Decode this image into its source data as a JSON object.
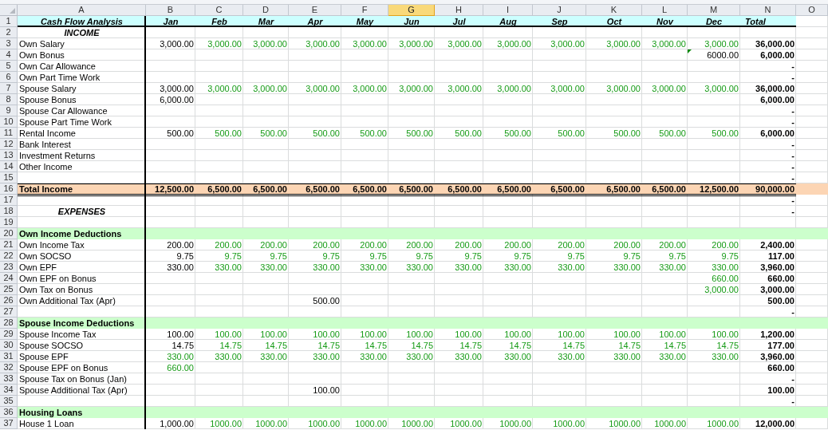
{
  "columns": [
    {
      "letter": "A",
      "selected": false
    },
    {
      "letter": "B",
      "selected": false
    },
    {
      "letter": "C",
      "selected": false
    },
    {
      "letter": "D",
      "selected": false
    },
    {
      "letter": "E",
      "selected": false
    },
    {
      "letter": "F",
      "selected": false
    },
    {
      "letter": "G",
      "selected": true
    },
    {
      "letter": "H",
      "selected": false
    },
    {
      "letter": "I",
      "selected": false
    },
    {
      "letter": "J",
      "selected": false
    },
    {
      "letter": "K",
      "selected": false
    },
    {
      "letter": "L",
      "selected": false
    },
    {
      "letter": "M",
      "selected": false
    },
    {
      "letter": "N",
      "selected": false
    },
    {
      "letter": "O",
      "selected": false
    }
  ],
  "rows": [
    {
      "number": "1",
      "kind": "heading",
      "label": "Cash Flow Analysis",
      "cells": [
        {
          "text": "Jan",
          "kind": "month"
        },
        {
          "text": "Feb",
          "kind": "month"
        },
        {
          "text": "Mar",
          "kind": "month"
        },
        {
          "text": "Apr",
          "kind": "month"
        },
        {
          "text": "May",
          "kind": "month"
        },
        {
          "text": "Jun",
          "kind": "month"
        },
        {
          "text": "Jul",
          "kind": "month"
        },
        {
          "text": "Aug",
          "kind": "month"
        },
        {
          "text": "Sep",
          "kind": "month"
        },
        {
          "text": "Oct",
          "kind": "month"
        },
        {
          "text": "Nov",
          "kind": "month"
        },
        {
          "text": "Dec",
          "kind": "month"
        },
        {
          "text": "Total",
          "kind": "caption"
        }
      ]
    },
    {
      "number": "2",
      "kind": "title",
      "label": "INCOME",
      "cells": []
    },
    {
      "number": "3",
      "kind": "item",
      "label": "Own Salary",
      "cells": [
        {
          "text": "3,000.00",
          "kind": "value"
        },
        {
          "text": "3,000.00",
          "kind": "input"
        },
        {
          "text": "3,000.00",
          "kind": "input"
        },
        {
          "text": "3,000.00",
          "kind": "input"
        },
        {
          "text": "3,000.00",
          "kind": "input"
        },
        {
          "text": "3,000.00",
          "kind": "input"
        },
        {
          "text": "3,000.00",
          "kind": "input"
        },
        {
          "text": "3,000.00",
          "kind": "input"
        },
        {
          "text": "3,000.00",
          "kind": "input"
        },
        {
          "text": "3,000.00",
          "kind": "input"
        },
        {
          "text": "3,000.00",
          "kind": "input"
        },
        {
          "text": "3,000.00",
          "kind": "input"
        },
        {
          "text": "36,000.00",
          "kind": "total"
        }
      ]
    },
    {
      "number": "4",
      "kind": "item",
      "label": "Own Bonus",
      "cells": [
        null,
        null,
        null,
        null,
        null,
        null,
        null,
        null,
        null,
        null,
        null,
        {
          "text": "6000.00",
          "kind": "flagged"
        },
        {
          "text": "6,000.00",
          "kind": "total"
        }
      ]
    },
    {
      "number": "5",
      "kind": "item",
      "label": "Own Car Allowance",
      "cells": [
        null,
        null,
        null,
        null,
        null,
        null,
        null,
        null,
        null,
        null,
        null,
        null,
        {
          "text": "-",
          "kind": "total"
        }
      ]
    },
    {
      "number": "6",
      "kind": "item",
      "label": "Own Part Time Work",
      "cells": [
        null,
        null,
        null,
        null,
        null,
        null,
        null,
        null,
        null,
        null,
        null,
        null,
        {
          "text": "-",
          "kind": "total"
        }
      ]
    },
    {
      "number": "7",
      "kind": "item",
      "label": "Spouse Salary",
      "cells": [
        {
          "text": "3,000.00",
          "kind": "value"
        },
        {
          "text": "3,000.00",
          "kind": "input"
        },
        {
          "text": "3,000.00",
          "kind": "input"
        },
        {
          "text": "3,000.00",
          "kind": "input"
        },
        {
          "text": "3,000.00",
          "kind": "input"
        },
        {
          "text": "3,000.00",
          "kind": "input"
        },
        {
          "text": "3,000.00",
          "kind": "input"
        },
        {
          "text": "3,000.00",
          "kind": "input"
        },
        {
          "text": "3,000.00",
          "kind": "input"
        },
        {
          "text": "3,000.00",
          "kind": "input"
        },
        {
          "text": "3,000.00",
          "kind": "input"
        },
        {
          "text": "3,000.00",
          "kind": "input"
        },
        {
          "text": "36,000.00",
          "kind": "total"
        }
      ]
    },
    {
      "number": "8",
      "kind": "item",
      "label": "Spouse Bonus",
      "cells": [
        {
          "text": "6,000.00",
          "kind": "value"
        },
        null,
        null,
        null,
        null,
        null,
        null,
        null,
        null,
        null,
        null,
        null,
        {
          "text": "6,000.00",
          "kind": "total"
        }
      ]
    },
    {
      "number": "9",
      "kind": "item",
      "label": "Spouse Car Allowance",
      "cells": [
        null,
        null,
        null,
        null,
        null,
        null,
        null,
        null,
        null,
        null,
        null,
        null,
        {
          "text": "-",
          "kind": "total"
        }
      ]
    },
    {
      "number": "10",
      "kind": "item",
      "label": "Spouse Part Time Work",
      "cells": [
        null,
        null,
        null,
        null,
        null,
        null,
        null,
        null,
        null,
        null,
        null,
        null,
        {
          "text": "-",
          "kind": "total"
        }
      ]
    },
    {
      "number": "11",
      "kind": "item",
      "label": "Rental Income",
      "cells": [
        {
          "text": "500.00",
          "kind": "value"
        },
        {
          "text": "500.00",
          "kind": "input"
        },
        {
          "text": "500.00",
          "kind": "input"
        },
        {
          "text": "500.00",
          "kind": "input"
        },
        {
          "text": "500.00",
          "kind": "input"
        },
        {
          "text": "500.00",
          "kind": "input"
        },
        {
          "text": "500.00",
          "kind": "input"
        },
        {
          "text": "500.00",
          "kind": "input"
        },
        {
          "text": "500.00",
          "kind": "input"
        },
        {
          "text": "500.00",
          "kind": "input"
        },
        {
          "text": "500.00",
          "kind": "input"
        },
        {
          "text": "500.00",
          "kind": "input"
        },
        {
          "text": "6,000.00",
          "kind": "total"
        }
      ]
    },
    {
      "number": "12",
      "kind": "item",
      "label": "Bank Interest",
      "cells": [
        null,
        null,
        null,
        null,
        null,
        null,
        null,
        null,
        null,
        null,
        null,
        null,
        {
          "text": "-",
          "kind": "total"
        }
      ]
    },
    {
      "number": "13",
      "kind": "item",
      "label": "Investment Returns",
      "cells": [
        null,
        null,
        null,
        null,
        null,
        null,
        null,
        null,
        null,
        null,
        null,
        null,
        {
          "text": "-",
          "kind": "total"
        }
      ]
    },
    {
      "number": "14",
      "kind": "item",
      "label": "Other Income",
      "cells": [
        null,
        null,
        null,
        null,
        null,
        null,
        null,
        null,
        null,
        null,
        null,
        null,
        {
          "text": "-",
          "kind": "total"
        }
      ]
    },
    {
      "number": "15",
      "kind": "item",
      "cells": [
        null,
        null,
        null,
        null,
        null,
        null,
        null,
        null,
        null,
        null,
        null,
        null,
        {
          "text": "-",
          "kind": "total"
        }
      ]
    },
    {
      "number": "16",
      "kind": "total",
      "label": "Total Income",
      "cells": [
        {
          "text": "12,500.00",
          "kind": "total"
        },
        {
          "text": "6,500.00",
          "kind": "total"
        },
        {
          "text": "6,500.00",
          "kind": "total"
        },
        {
          "text": "6,500.00",
          "kind": "total"
        },
        {
          "text": "6,500.00",
          "kind": "total"
        },
        {
          "text": "6,500.00",
          "kind": "total"
        },
        {
          "text": "6,500.00",
          "kind": "total"
        },
        {
          "text": "6,500.00",
          "kind": "total"
        },
        {
          "text": "6,500.00",
          "kind": "total"
        },
        {
          "text": "6,500.00",
          "kind": "total"
        },
        {
          "text": "6,500.00",
          "kind": "total"
        },
        {
          "text": "12,500.00",
          "kind": "total"
        },
        {
          "text": "90,000.00",
          "kind": "total"
        }
      ]
    },
    {
      "number": "17",
      "kind": "item",
      "cells": [
        null,
        null,
        null,
        null,
        null,
        null,
        null,
        null,
        null,
        null,
        null,
        null,
        {
          "text": "-",
          "kind": "total"
        }
      ]
    },
    {
      "number": "18",
      "kind": "title",
      "label": "EXPENSES",
      "cells": [
        null,
        null,
        null,
        null,
        null,
        null,
        null,
        null,
        null,
        null,
        null,
        null,
        {
          "text": "-",
          "kind": "total"
        }
      ]
    },
    {
      "number": "19",
      "kind": "item",
      "cells": []
    },
    {
      "number": "20",
      "kind": "section",
      "label": "Own Income Deductions",
      "cells": []
    },
    {
      "number": "21",
      "kind": "item",
      "label": "Own Income Tax",
      "cells": [
        {
          "text": "200.00",
          "kind": "value"
        },
        {
          "text": "200.00",
          "kind": "input"
        },
        {
          "text": "200.00",
          "kind": "input"
        },
        {
          "text": "200.00",
          "kind": "input"
        },
        {
          "text": "200.00",
          "kind": "input"
        },
        {
          "text": "200.00",
          "kind": "input"
        },
        {
          "text": "200.00",
          "kind": "input"
        },
        {
          "text": "200.00",
          "kind": "input"
        },
        {
          "text": "200.00",
          "kind": "input"
        },
        {
          "text": "200.00",
          "kind": "input"
        },
        {
          "text": "200.00",
          "kind": "input"
        },
        {
          "text": "200.00",
          "kind": "input"
        },
        {
          "text": "2,400.00",
          "kind": "total"
        }
      ]
    },
    {
      "number": "22",
      "kind": "item",
      "label": "Own SOCSO",
      "cells": [
        {
          "text": "9.75",
          "kind": "value"
        },
        {
          "text": "9.75",
          "kind": "input"
        },
        {
          "text": "9.75",
          "kind": "input"
        },
        {
          "text": "9.75",
          "kind": "input"
        },
        {
          "text": "9.75",
          "kind": "input"
        },
        {
          "text": "9.75",
          "kind": "input"
        },
        {
          "text": "9.75",
          "kind": "input"
        },
        {
          "text": "9.75",
          "kind": "input"
        },
        {
          "text": "9.75",
          "kind": "input"
        },
        {
          "text": "9.75",
          "kind": "input"
        },
        {
          "text": "9.75",
          "kind": "input"
        },
        {
          "text": "9.75",
          "kind": "input"
        },
        {
          "text": "117.00",
          "kind": "total"
        }
      ]
    },
    {
      "number": "23",
      "kind": "item",
      "label": "Own EPF",
      "cells": [
        {
          "text": "330.00",
          "kind": "value"
        },
        {
          "text": "330.00",
          "kind": "input"
        },
        {
          "text": "330.00",
          "kind": "input"
        },
        {
          "text": "330.00",
          "kind": "input"
        },
        {
          "text": "330.00",
          "kind": "input"
        },
        {
          "text": "330.00",
          "kind": "input"
        },
        {
          "text": "330.00",
          "kind": "input"
        },
        {
          "text": "330.00",
          "kind": "input"
        },
        {
          "text": "330.00",
          "kind": "input"
        },
        {
          "text": "330.00",
          "kind": "input"
        },
        {
          "text": "330.00",
          "kind": "input"
        },
        {
          "text": "330.00",
          "kind": "input"
        },
        {
          "text": "3,960.00",
          "kind": "total"
        }
      ]
    },
    {
      "number": "24",
      "kind": "item",
      "label": "Own EPF on Bonus",
      "cells": [
        null,
        null,
        null,
        null,
        null,
        null,
        null,
        null,
        null,
        null,
        null,
        {
          "text": "660.00",
          "kind": "input"
        },
        {
          "text": "660.00",
          "kind": "total"
        }
      ]
    },
    {
      "number": "25",
      "kind": "item",
      "label": "Own Tax on Bonus",
      "cells": [
        null,
        null,
        null,
        null,
        null,
        null,
        null,
        null,
        null,
        null,
        null,
        {
          "text": "3,000.00",
          "kind": "input"
        },
        {
          "text": "3,000.00",
          "kind": "total"
        }
      ]
    },
    {
      "number": "26",
      "kind": "item",
      "label": "Own Additional Tax (Apr)",
      "cells": [
        null,
        null,
        null,
        {
          "text": "500.00",
          "kind": "value"
        },
        null,
        null,
        null,
        null,
        null,
        null,
        null,
        null,
        {
          "text": "500.00",
          "kind": "total"
        }
      ]
    },
    {
      "number": "27",
      "kind": "item",
      "cells": [
        null,
        null,
        null,
        null,
        null,
        null,
        null,
        null,
        null,
        null,
        null,
        null,
        {
          "text": "-",
          "kind": "total"
        }
      ]
    },
    {
      "number": "28",
      "kind": "section",
      "label": "Spouse Income Deductions",
      "cells": []
    },
    {
      "number": "29",
      "kind": "item",
      "label": "Spouse Income Tax",
      "cells": [
        {
          "text": "100.00",
          "kind": "value"
        },
        {
          "text": "100.00",
          "kind": "input"
        },
        {
          "text": "100.00",
          "kind": "input"
        },
        {
          "text": "100.00",
          "kind": "input"
        },
        {
          "text": "100.00",
          "kind": "input"
        },
        {
          "text": "100.00",
          "kind": "input"
        },
        {
          "text": "100.00",
          "kind": "input"
        },
        {
          "text": "100.00",
          "kind": "input"
        },
        {
          "text": "100.00",
          "kind": "input"
        },
        {
          "text": "100.00",
          "kind": "input"
        },
        {
          "text": "100.00",
          "kind": "input"
        },
        {
          "text": "100.00",
          "kind": "input"
        },
        {
          "text": "1,200.00",
          "kind": "total"
        }
      ]
    },
    {
      "number": "30",
      "kind": "item",
      "label": "Spouse SOCSO",
      "cells": [
        {
          "text": "14.75",
          "kind": "value"
        },
        {
          "text": "14.75",
          "kind": "input"
        },
        {
          "text": "14.75",
          "kind": "input"
        },
        {
          "text": "14.75",
          "kind": "input"
        },
        {
          "text": "14.75",
          "kind": "input"
        },
        {
          "text": "14.75",
          "kind": "input"
        },
        {
          "text": "14.75",
          "kind": "input"
        },
        {
          "text": "14.75",
          "kind": "input"
        },
        {
          "text": "14.75",
          "kind": "input"
        },
        {
          "text": "14.75",
          "kind": "input"
        },
        {
          "text": "14.75",
          "kind": "input"
        },
        {
          "text": "14.75",
          "kind": "input"
        },
        {
          "text": "177.00",
          "kind": "total"
        }
      ]
    },
    {
      "number": "31",
      "kind": "item",
      "label": "Spouse EPF",
      "cells": [
        {
          "text": "330.00",
          "kind": "input"
        },
        {
          "text": "330.00",
          "kind": "input"
        },
        {
          "text": "330.00",
          "kind": "input"
        },
        {
          "text": "330.00",
          "kind": "input"
        },
        {
          "text": "330.00",
          "kind": "input"
        },
        {
          "text": "330.00",
          "kind": "input"
        },
        {
          "text": "330.00",
          "kind": "input"
        },
        {
          "text": "330.00",
          "kind": "input"
        },
        {
          "text": "330.00",
          "kind": "input"
        },
        {
          "text": "330.00",
          "kind": "input"
        },
        {
          "text": "330.00",
          "kind": "input"
        },
        {
          "text": "330.00",
          "kind": "input"
        },
        {
          "text": "3,960.00",
          "kind": "total"
        }
      ]
    },
    {
      "number": "32",
      "kind": "item",
      "label": "Spouse EPF on Bonus",
      "cells": [
        {
          "text": "660.00",
          "kind": "input"
        },
        null,
        null,
        null,
        null,
        null,
        null,
        null,
        null,
        null,
        null,
        null,
        {
          "text": "660.00",
          "kind": "total"
        }
      ]
    },
    {
      "number": "33",
      "kind": "item",
      "label": "Spouse Tax on Bonus (Jan)",
      "cells": [
        null,
        null,
        null,
        null,
        null,
        null,
        null,
        null,
        null,
        null,
        null,
        null,
        {
          "text": "-",
          "kind": "total"
        }
      ]
    },
    {
      "number": "34",
      "kind": "item",
      "label": "Spouse Additional Tax (Apr)",
      "cells": [
        null,
        null,
        null,
        {
          "text": "100.00",
          "kind": "value"
        },
        null,
        null,
        null,
        null,
        null,
        null,
        null,
        null,
        {
          "text": "100.00",
          "kind": "total"
        }
      ]
    },
    {
      "number": "35",
      "kind": "item",
      "cells": [
        null,
        null,
        null,
        null,
        null,
        null,
        null,
        null,
        null,
        null,
        null,
        null,
        {
          "text": "-",
          "kind": "total"
        }
      ]
    },
    {
      "number": "36",
      "kind": "section",
      "label": "Housing Loans",
      "cells": []
    },
    {
      "number": "37",
      "kind": "item",
      "label": "House 1 Loan",
      "cells": [
        {
          "text": "1,000.00",
          "kind": "value"
        },
        {
          "text": "1000.00",
          "kind": "input"
        },
        {
          "text": "1000.00",
          "kind": "input"
        },
        {
          "text": "1000.00",
          "kind": "input"
        },
        {
          "text": "1000.00",
          "kind": "input"
        },
        {
          "text": "1000.00",
          "kind": "input"
        },
        {
          "text": "1000.00",
          "kind": "input"
        },
        {
          "text": "1000.00",
          "kind": "input"
        },
        {
          "text": "1000.00",
          "kind": "input"
        },
        {
          "text": "1000.00",
          "kind": "input"
        },
        {
          "text": "1000.00",
          "kind": "input"
        },
        {
          "text": "1000.00",
          "kind": "input"
        },
        {
          "text": "12,000.00",
          "kind": "total"
        }
      ]
    }
  ]
}
